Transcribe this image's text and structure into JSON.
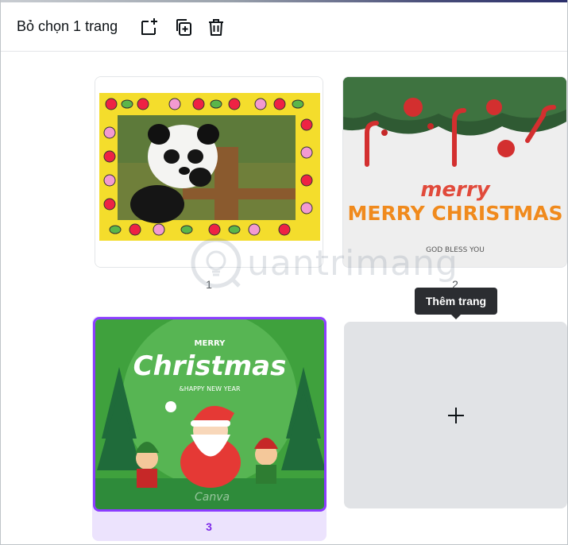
{
  "toolbar": {
    "title": "Bỏ chọn 1 trang",
    "icons": [
      "add-page-icon",
      "duplicate-page-icon",
      "delete-icon"
    ]
  },
  "pages": [
    {
      "number": "1",
      "selected": false,
      "description_icon": "panda-flower-frame"
    },
    {
      "number": "2",
      "selected": false,
      "card_title": "MERRY CHRISTMAS",
      "card_subtitle": "GOD BLESS YOU"
    },
    {
      "number": "3",
      "selected": true,
      "card_title_top": "MERRY",
      "card_title": "Christmas",
      "card_subtitle": "&HAPPY NEW YEAR",
      "brand": "Canva"
    }
  ],
  "add_page": {
    "tooltip": "Thêm trang",
    "icon": "plus-icon"
  },
  "watermark": {
    "text": "uantrimang",
    "letter": "Q"
  },
  "colors": {
    "selection": "#8b3dff",
    "selection_bg": "#ece3fd",
    "tooltip_bg": "#2b2d31",
    "add_card_bg": "#e1e3e6"
  }
}
